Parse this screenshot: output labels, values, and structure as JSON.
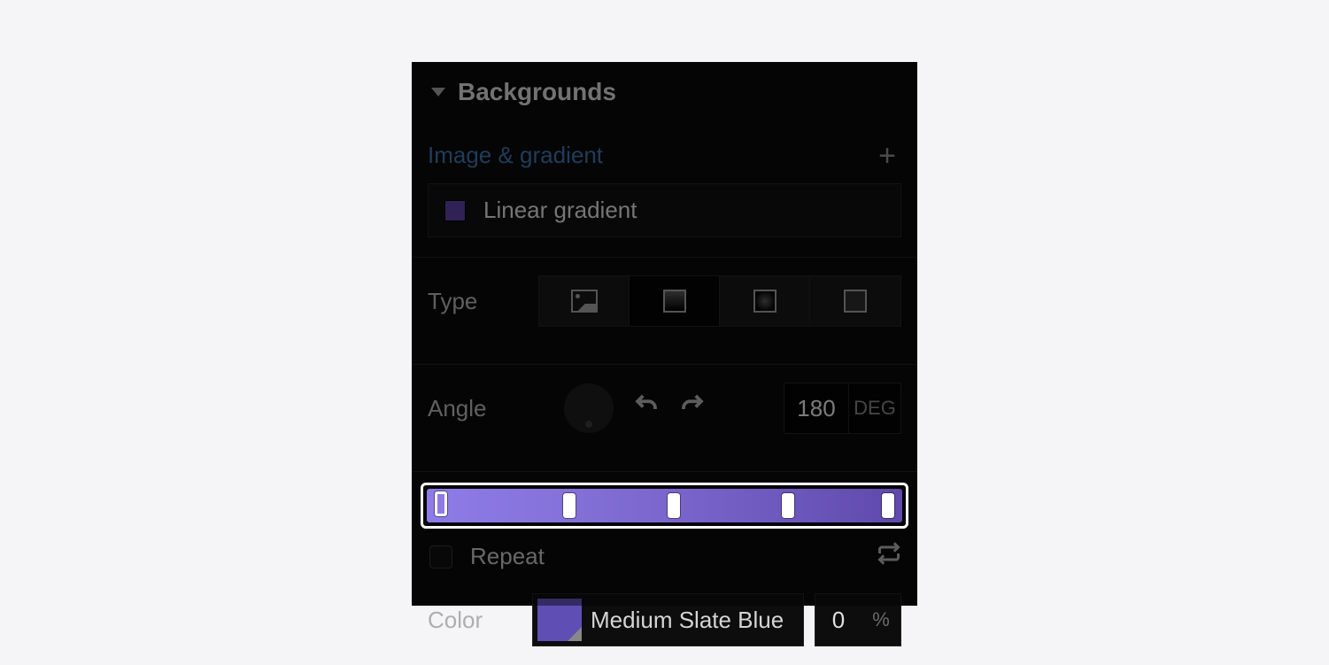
{
  "section": {
    "title": "Backgrounds"
  },
  "subheader": {
    "label": "Image & gradient"
  },
  "layer": {
    "name": "Linear gradient",
    "swatch_color": "#5a3e9c"
  },
  "type": {
    "label": "Type",
    "options": [
      "image",
      "linear",
      "radial",
      "solid"
    ],
    "selected_index": 1
  },
  "angle": {
    "label": "Angle",
    "value": "180",
    "unit": "DEG"
  },
  "gradient": {
    "stops_percent": [
      0,
      28,
      50,
      75,
      97
    ],
    "active_stop_index": 0,
    "colors": [
      "#8e7be8",
      "#8674db",
      "#7a66cd",
      "#6d58bd",
      "#5f49ab"
    ]
  },
  "repeat": {
    "label": "Repeat",
    "checked": false
  },
  "color": {
    "label": "Color",
    "name": "Medium Slate Blue",
    "swatch": "#5f4fb5",
    "position": "0",
    "unit": "%"
  }
}
